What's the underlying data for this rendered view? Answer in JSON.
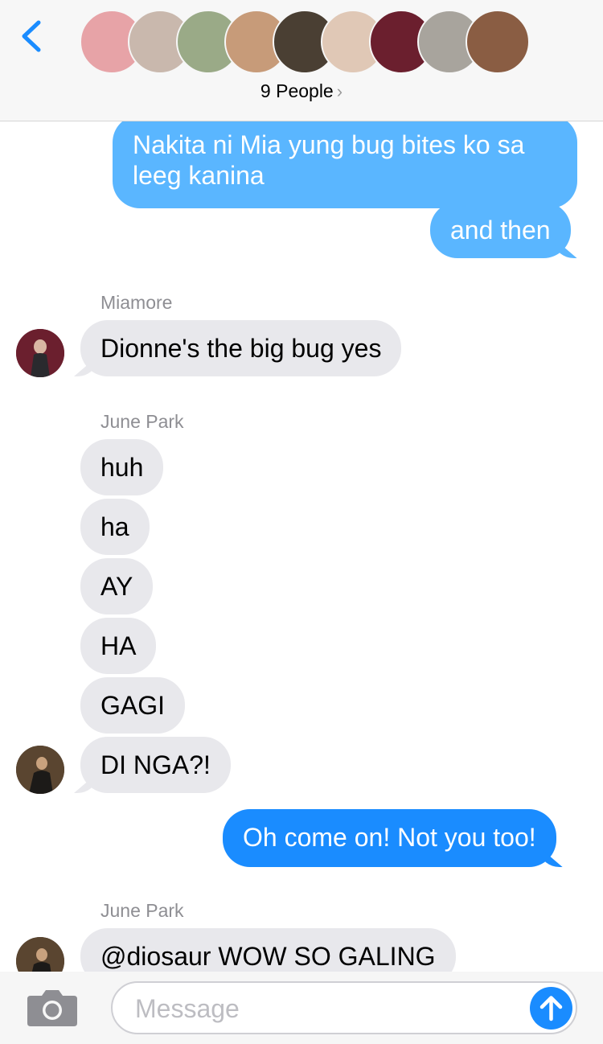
{
  "header": {
    "people_label": "9 People",
    "avatar_colors": [
      "#e7a3a7",
      "#c9b8ad",
      "#9aaa87",
      "#c79b79",
      "#4a3f33",
      "#e0c8b6",
      "#6b1f2e",
      "#a8a49d",
      "#8a5d43"
    ]
  },
  "thread": {
    "out1_text": "Nakita ni Mia yung bug bites ko sa leeg kanina",
    "out2_text": "and then",
    "group1_sender": "Miamore",
    "group1_msg": "Dionne's the big bug yes",
    "group2_sender": "June Park",
    "group2_msgs": [
      "huh",
      "ha",
      "AY",
      "HA",
      "GAGI",
      "DI NGA?!"
    ],
    "out3_text": "Oh come on! Not you too!",
    "group3_sender": "June Park",
    "group3_msg": "@diosaur WOW SO GALING"
  },
  "input": {
    "placeholder": "Message"
  },
  "colors": {
    "sms_blue": "#5ab6ff",
    "imessage_blue": "#1a8cff",
    "incoming_gray": "#e8e8ec"
  }
}
